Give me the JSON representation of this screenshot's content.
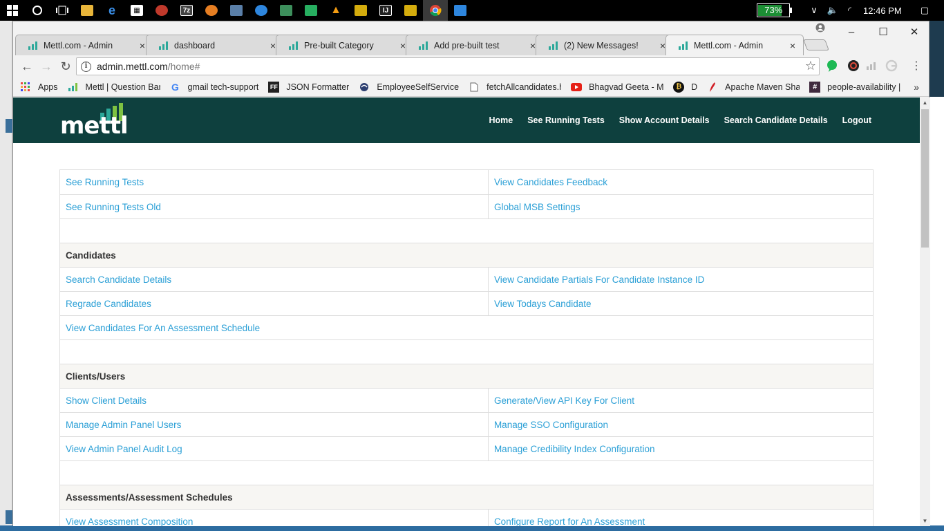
{
  "taskbar": {
    "battery_percent": "73%",
    "battery_level": 0.73,
    "time": "12:46 PM",
    "icons": [
      "windows-start-icon",
      "cortana-icon",
      "task-view-icon",
      "file-explorer-icon",
      "edge-icon",
      "store-icon",
      "app-icon-1",
      "app-icon-2",
      "app-icon-3",
      "app-icon-4",
      "app-icon-5",
      "app-icon-6",
      "app-icon-7",
      "vlc-icon",
      "app-icon-8",
      "intellij-icon",
      "app-icon-9",
      "chrome-icon",
      "app-icon-10"
    ]
  },
  "browser": {
    "tabs": [
      {
        "title": "Mettl.com - Admin",
        "active": false
      },
      {
        "title": "dashboard",
        "active": false
      },
      {
        "title": "Pre-built Category",
        "active": false
      },
      {
        "title": "Add pre-built test",
        "active": false
      },
      {
        "title": "(2) New Messages!",
        "active": false
      },
      {
        "title": "Mettl.com - Admin",
        "active": true
      }
    ],
    "close_glyph": "×",
    "url_host": "admin.mettl.com",
    "url_path": "/home#",
    "bookmarks": [
      {
        "label": "Apps",
        "icon": "apps-grid-icon"
      },
      {
        "label": "Mettl | Question Ban",
        "icon": "mettl-icon"
      },
      {
        "label": "gmail tech-support",
        "icon": "google-icon"
      },
      {
        "label": "JSON Formatter",
        "icon": "ff-icon"
      },
      {
        "label": "EmployeeSelfService",
        "icon": "ess-icon"
      },
      {
        "label": "fetchAllcandidates.h",
        "icon": "file-icon"
      },
      {
        "label": "Bhagvad Geeta - Ma",
        "icon": "youtube-icon"
      },
      {
        "label": "D",
        "icon": "bitcoin-icon"
      },
      {
        "label": "Apache Maven Shad",
        "icon": "apache-icon"
      },
      {
        "label": "people-availability |",
        "icon": "slack-icon"
      }
    ],
    "bookmarks_more": "»"
  },
  "site": {
    "logo": "mettl",
    "nav": [
      "Home",
      "See Running Tests",
      "Show Account Details",
      "Search Candidate Details",
      "Logout"
    ]
  },
  "grid": {
    "r1": [
      "See Running Tests",
      "View Candidates Feedback"
    ],
    "r2": [
      "See Running Tests Old",
      "Global MSB Settings"
    ],
    "h_candidates": "Candidates",
    "r3": [
      "Search Candidate Details",
      "View Candidate Partials For Candidate Instance ID"
    ],
    "r4": [
      "Regrade Candidates",
      "View Todays Candidate"
    ],
    "r5": [
      "View Candidates For An Assessment Schedule"
    ],
    "h_clients": "Clients/Users",
    "r6": [
      "Show Client Details",
      "Generate/View API Key For Client"
    ],
    "r7": [
      "Manage Admin Panel Users",
      "Manage SSO Configuration"
    ],
    "r8": [
      "View Admin Panel Audit Log",
      "Manage Credibility Index Configuration"
    ],
    "h_assessments": "Assessments/Assessment Schedules",
    "r9": [
      "View Assessment Composition",
      "Configure Report for An Assessment"
    ]
  },
  "colors": {
    "header_bg": "#0e403e",
    "link": "#2a9fd6",
    "section_bg": "#f7f6f3"
  }
}
